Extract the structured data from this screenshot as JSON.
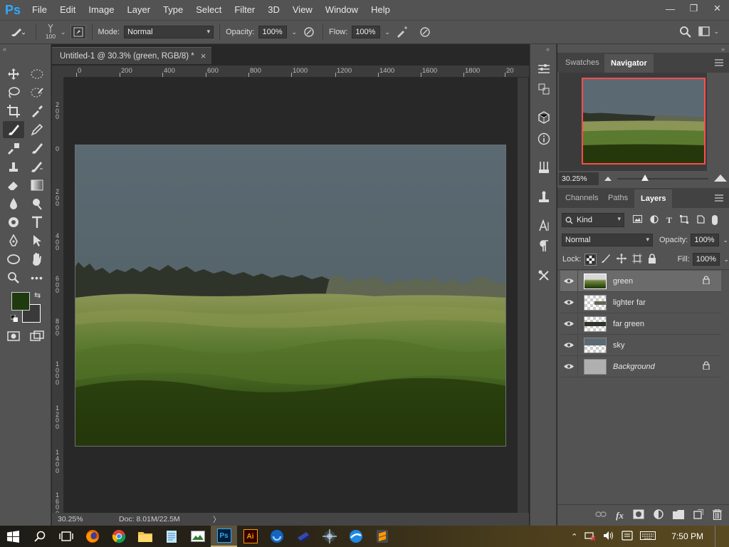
{
  "app": {
    "logo": "Ps"
  },
  "menu": [
    "File",
    "Edit",
    "Image",
    "Layer",
    "Type",
    "Select",
    "Filter",
    "3D",
    "View",
    "Window",
    "Help"
  ],
  "window_controls": {
    "minimize": "—",
    "restore": "❐",
    "close": "✕"
  },
  "options": {
    "brush_size": "100",
    "mode_label": "Mode:",
    "mode_value": "Normal",
    "opacity_label": "Opacity:",
    "opacity_value": "100%",
    "flow_label": "Flow:",
    "flow_value": "100%"
  },
  "document": {
    "tab_title": "Untitled-1 @ 30.3% (green, RGB/8) *",
    "tab_close": "×",
    "ruler_top": [
      "0",
      "200",
      "400",
      "600",
      "800",
      "1000",
      "1200",
      "1400",
      "1600",
      "1800",
      "20"
    ],
    "ruler_left": [
      "2\n0\n0",
      "0",
      "2\n0\n0",
      "4\n0\n0",
      "6\n0\n0",
      "8\n0\n0",
      "1\n0\n0\n0",
      "1\n2\n0\n0",
      "1\n4\n0\n0",
      "1\n6\n0\n0"
    ],
    "zoom": "30.25%",
    "doc_info": "Doc: 8.01M/22.5M"
  },
  "navigator": {
    "tabs": [
      "Swatches",
      "Navigator"
    ],
    "active_tab": "Navigator",
    "zoom": "30.25%",
    "frame_color": "#ff4c4c"
  },
  "layers_panel": {
    "tabs": [
      "Channels",
      "Paths",
      "Layers"
    ],
    "active_tab": "Layers",
    "filter_label": "Kind",
    "blend_mode": "Normal",
    "opacity_label": "Opacity:",
    "opacity_value": "100%",
    "lock_label": "Lock:",
    "fill_label": "Fill:",
    "fill_value": "100%",
    "layers": [
      {
        "name": "green",
        "visible": true,
        "locked": true,
        "selected": true
      },
      {
        "name": "lighter far",
        "visible": true,
        "locked": false,
        "selected": false
      },
      {
        "name": "far green",
        "visible": true,
        "locked": false,
        "selected": false
      },
      {
        "name": "sky",
        "visible": true,
        "locked": false,
        "selected": false
      },
      {
        "name": "Background",
        "visible": true,
        "locked": true,
        "selected": false
      }
    ]
  },
  "colors": {
    "foreground": "#1e3a0e",
    "background": "#ffffff",
    "sky": "#5b6a72",
    "dark_trees": "#2f342b",
    "light_trees": "#5f6652",
    "grass_far": "#7c8c46",
    "grass_mid": "#4a6a25",
    "grass_near": "#25380b"
  },
  "taskbar": {
    "time": "7:50 PM",
    "apps": [
      "start-icon",
      "search-icon",
      "task-view-icon",
      "firefox-icon",
      "chrome-icon",
      "file-explorer-icon",
      "notepad-icon",
      "photos-icon",
      "photoshop-icon",
      "illustrator-icon",
      "app-icon-1",
      "app-icon-2",
      "app-icon-3",
      "app-icon-4",
      "sublime-icon"
    ],
    "active_app": "photoshop-icon"
  }
}
